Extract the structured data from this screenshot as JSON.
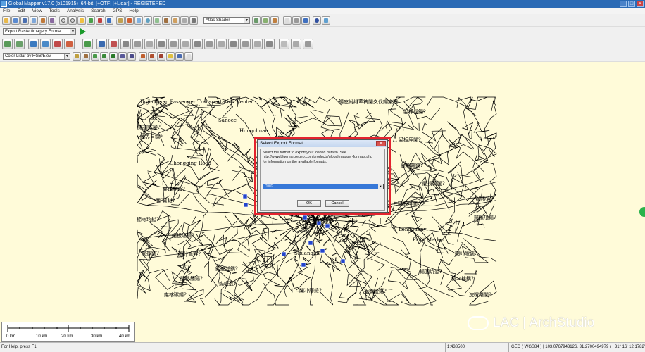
{
  "window": {
    "title": "Global Mapper v17.0 (b101915) [64-bit] [+OTF] [+Lidar] - REGISTERED"
  },
  "menu": [
    "File",
    "Edit",
    "View",
    "Tools",
    "Analysis",
    "Search",
    "GPS",
    "Help"
  ],
  "toolbar": {
    "shader_select": "Atlas Shader",
    "export_select": "Export Raster/Imagery Format...",
    "lidar_select": "Color Lidar by RGB/Elev"
  },
  "map": {
    "labels": [
      "Dujiangyan Passenger Transportation Center",
      "Sanoec",
      "Hongchuan",
      "Chongqing Road",
      "Chengdu",
      "Shuangliu",
      "Fruit Market",
      "Longquanyi",
      "鍚庢紨绯荤粺閫夊伐鍚庡寲",
      "鍖楃敤鑾?",
      "閮界旦鍚?",
      "鍫瑰笌鍞?",
      "閿″寳鍖?",
      "鍗庤瑢鎰?",
      "鏂板簻鎻?",
      "閬撳鍦?",
      "閰╁尯鍥?",
      "鍗庢湁鍝?",
      "閲嶅簡鍚?",
      "鐑崕宸?",
      "闃冲厜鍏?",
      "鍙嬭皧鍖?",
      "鍖楁磥鍚?",
      "浣曢槼閫?",
      "鍙板厓閫?",
      "鍙嬩竷鍐?",
      "閭撹矾閫?",
      "鍦颁竴閫?",
      "鍞嚟宸?",
      "鍏嬪瓨鍚?",
      "鍘屽叆鍦?",
      "鍚囬炕鍙?",
      "鍏ユ槦鍝?",
      "鍙樺伐鍚?"
    ]
  },
  "dialog": {
    "title": "Select Export Format",
    "message_lines": [
      "Select the format to export your loaded data to. See",
      "http://www.bluemarblegeo.com/products/global-mapper-formats.php",
      "for information on the available formats."
    ],
    "selected_format": "DWG",
    "ok_label": "OK",
    "cancel_label": "Cancel"
  },
  "scalebar": {
    "labels": [
      "0 km",
      "10 km",
      "20 km",
      "30 km",
      "40 km"
    ]
  },
  "watermark": {
    "text": "LAC | ArchStudio"
  },
  "status": {
    "help": "For Help, press F1",
    "scale": "1:438500",
    "coordinates": "GEO ( WGS84 ) | 103.0767943126, 31.2700494979 ) | 31° 16' 12.1782\" N, 103° 04' 36.4595\" E"
  },
  "colors": {
    "map_background": "#fffbd9",
    "highlight_frame": "#e4232e",
    "selection": "#3778d8"
  }
}
